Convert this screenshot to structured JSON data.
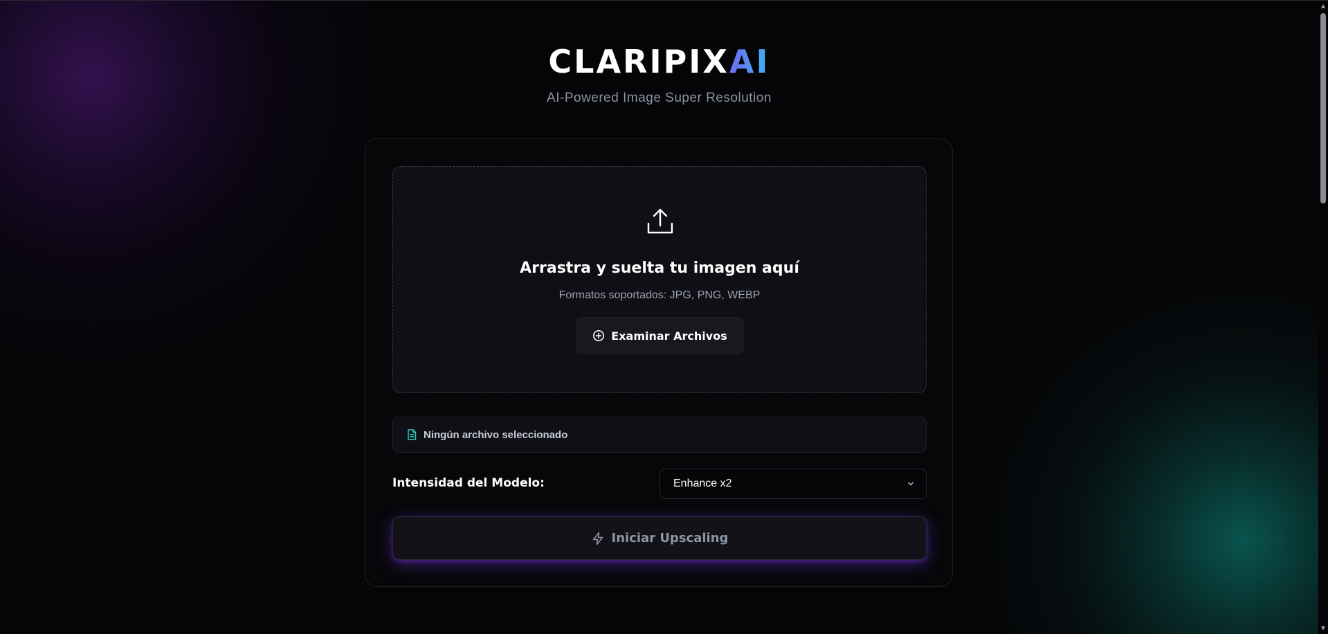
{
  "header": {
    "logo_main": "CLARIPIX",
    "logo_accent": "AI",
    "tagline": "AI-Powered Image Super Resolution"
  },
  "upload": {
    "icon": "upload-icon",
    "title": "Arrastra y suelta tu imagen aquí",
    "formats": "Formatos soportados: JPG, PNG, WEBP",
    "browse_button": {
      "icon": "plus-circle-icon",
      "label": "Examinar Archivos"
    }
  },
  "file_status": {
    "icon": "file-icon",
    "text": "Ningún archivo seleccionado"
  },
  "model": {
    "label": "Intensidad del Modelo:",
    "selected": "Enhance x2",
    "icon": "chevron-down-icon"
  },
  "start_button": {
    "icon": "lightning-icon",
    "label": "Iniciar Upscaling"
  },
  "colors": {
    "accent_gradient_start": "#6d6cf5",
    "accent_gradient_end": "#3fb4f0",
    "file_icon": "#2dd4bf",
    "glow": "#7c3aed",
    "background": "#050507"
  }
}
